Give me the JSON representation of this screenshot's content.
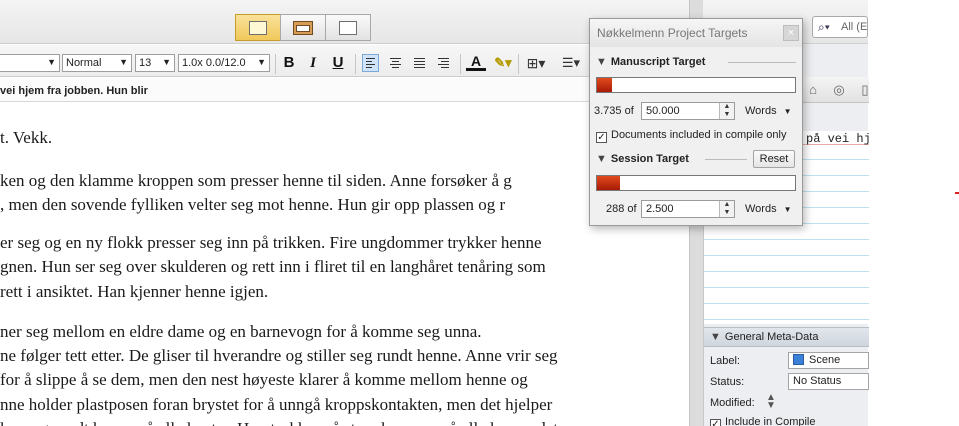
{
  "toolbar": {
    "view_modes": [
      "scrivenings-icon",
      "corkboard-icon",
      "outliner-icon"
    ],
    "search_placeholder": "All (E"
  },
  "format_bar": {
    "font_family": "",
    "style": "Normal",
    "size": "13",
    "spacing": "1.0x 0.0/12.0",
    "bold": "B",
    "italic": "I",
    "underline": "U"
  },
  "editor": {
    "header_text": "vei hjem fra jobben. Hun blir",
    "lines": [
      "t. Vekk.",
      "ken og den klamme kroppen som presser henne til siden. Anne forsøker å g",
      ", men den sovende fylliken velter seg mot henne. Hun gir opp plassen og r",
      "er seg og en ny flokk presser seg inn på trikken. Fire ungdommer trykker henne",
      "gnen. Hun ser seg over skulderen og rett inn i fliret til en langhåret tenåring som",
      " rett i ansiktet. Han kjenner henne igjen.",
      "ner seg mellom en eldre dame og en barnevogn for å komme seg unna.",
      "ne følger tett etter. De gliser til hverandre og stiller seg rundt henne. Anne vrir seg",
      " for å slippe å se dem, men den nest høyeste klarer å komme mellom henne og",
      "nne holder plastposen foran brystet for å unngå kroppskontakten, men det hjelper",
      "ker seg rundt henne på alle kanter. Hun trykker på stoppknappen så alle kan se det"
    ]
  },
  "inspector": {
    "notes_text": "på vei hj",
    "meta_header": "General Meta-Data",
    "label_label": "Label:",
    "label_value": "Scene",
    "status_label": "Status:",
    "status_value": "No Status",
    "modified_label": "Modified:",
    "include_label": "Include in Compile",
    "colors": {
      "scene_chip": "#3a7fd8"
    }
  },
  "targets_popup": {
    "title": "Nøkkelmenn Project Targets",
    "manuscript_header": "Manuscript Target",
    "manuscript_progress": 0.075,
    "manuscript_count": "3.735 of",
    "manuscript_target": "50.000",
    "manuscript_unit": "Words",
    "compile_only_label": "Documents included in compile only",
    "session_header": "Session Target",
    "reset_label": "Reset",
    "session_progress": 0.115,
    "session_count": "288 of",
    "session_target": "2.500",
    "session_unit": "Words",
    "colors": {
      "progress": "#c42a0c"
    }
  }
}
